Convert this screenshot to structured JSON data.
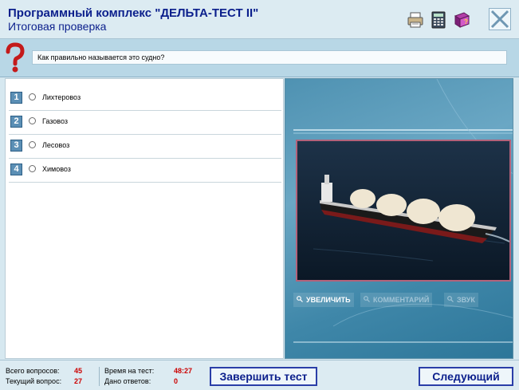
{
  "header": {
    "title": "Программный комплекс \"ДЕЛЬТА-ТЕСТ II\"",
    "subtitle": "Итоговая проверка",
    "tools": [
      {
        "icon": "printer-icon"
      },
      {
        "icon": "calculator-icon"
      },
      {
        "icon": "book-icon"
      },
      {
        "icon": "close-icon"
      }
    ]
  },
  "question": {
    "icon": "question-mark-icon",
    "text": "Как правильно называется это судно?"
  },
  "answers": [
    {
      "number": "1",
      "label": "Лихтеровоз",
      "selected": false
    },
    {
      "number": "2",
      "label": "Газовоз",
      "selected": false
    },
    {
      "number": "3",
      "label": "Лесовоз",
      "selected": false
    },
    {
      "number": "4",
      "label": "Химовоз",
      "selected": false
    }
  ],
  "media": {
    "image": "lng-tanker-ship-photo",
    "buttons": [
      {
        "label": "УВЕЛИЧИТЬ",
        "enabled": true
      },
      {
        "label": "КОММЕНТАРИЙ",
        "enabled": false
      },
      {
        "label": "ЗВУК",
        "enabled": false
      }
    ]
  },
  "footer": {
    "total_label": "Всего вопросов:",
    "total_value": "45",
    "current_label": "Текущий вопрос:",
    "current_value": "27",
    "time_label": "Время на тест:",
    "time_value": "48:27",
    "answered_label": "Дано ответов:",
    "answered_value": "0",
    "finish_label": "Завершить тест",
    "next_label": "Следующий"
  },
  "colors": {
    "title_blue": "#0b1f8c",
    "stat_red": "#cc0000",
    "panel_bg": "#d6e8f0"
  }
}
